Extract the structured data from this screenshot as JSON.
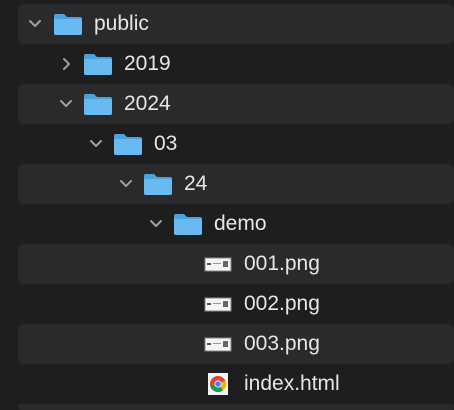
{
  "tree": {
    "items": [
      {
        "label": "public",
        "icon": "folder-icon",
        "state": "expanded"
      },
      {
        "label": "2019",
        "icon": "folder-icon",
        "state": "collapsed"
      },
      {
        "label": "2024",
        "icon": "folder-icon",
        "state": "expanded"
      },
      {
        "label": "03",
        "icon": "folder-icon",
        "state": "expanded"
      },
      {
        "label": "24",
        "icon": "folder-icon",
        "state": "expanded"
      },
      {
        "label": "demo",
        "icon": "folder-icon",
        "state": "expanded"
      },
      {
        "label": "001.png",
        "icon": "png-file-icon"
      },
      {
        "label": "002.png",
        "icon": "png-file-icon"
      },
      {
        "label": "003.png",
        "icon": "png-file-icon"
      },
      {
        "label": "index.html",
        "icon": "chrome-html-file-icon"
      }
    ]
  },
  "colors": {
    "background": "#1e1e1e",
    "stripe": "#2a2a2c",
    "text": "#e6e6e6",
    "chevron": "#a0a0a0",
    "folder": "#5fb3ea"
  }
}
